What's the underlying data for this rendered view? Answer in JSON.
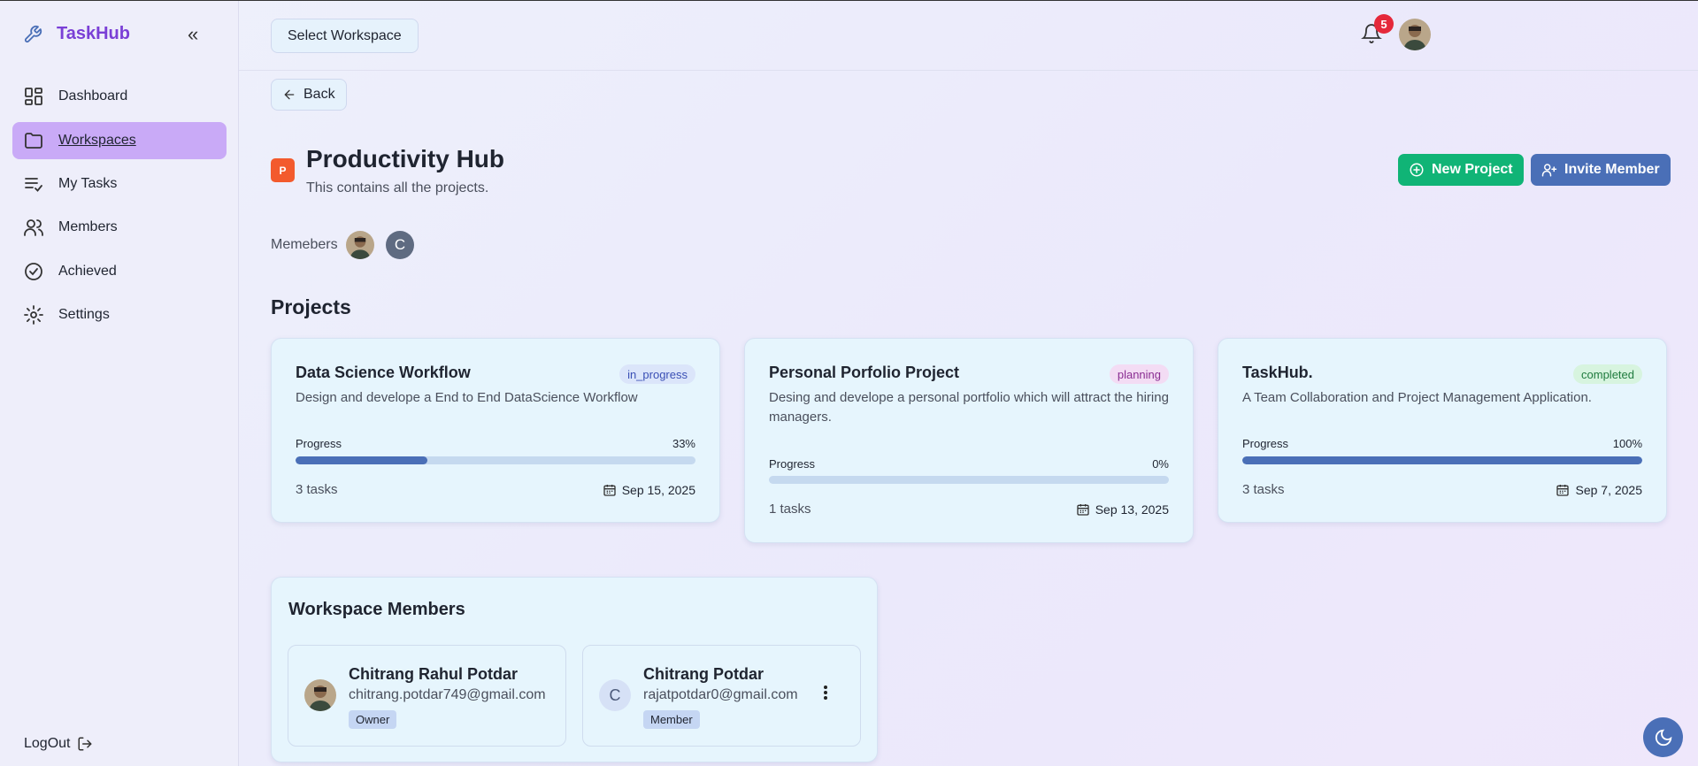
{
  "app": {
    "name": "TaskHub"
  },
  "sidebar": {
    "items": [
      {
        "label": "Dashboard",
        "icon": "dashboard-icon"
      },
      {
        "label": "Workspaces",
        "icon": "folder-icon",
        "active": true
      },
      {
        "label": "My Tasks",
        "icon": "list-check-icon"
      },
      {
        "label": "Members",
        "icon": "users-icon"
      },
      {
        "label": "Achieved",
        "icon": "check-circle-icon"
      },
      {
        "label": "Settings",
        "icon": "gear-icon"
      }
    ],
    "logout": "LogOut"
  },
  "header": {
    "workspace_select": "Select Workspace",
    "notifications": "5"
  },
  "workspace": {
    "back": "Back",
    "initial": "P",
    "name": "Productivity Hub",
    "description": "This contains all the projects.",
    "members_label": "Memebers",
    "member_initial": "C",
    "new_project": "New Project",
    "invite_member": "Invite Member"
  },
  "projects": {
    "heading": "Projects",
    "progress_label": "Progress",
    "list": [
      {
        "title": "Data Science Workflow",
        "status": "in_progress",
        "description": "Design and develope a End to End DataScience Workflow",
        "progress": 33,
        "progress_text": "33%",
        "tasks": "3 tasks",
        "due": "Sep 15, 2025"
      },
      {
        "title": "Personal Porfolio Project",
        "status": "planning",
        "description": "Desing and develope a personal portfolio which will attract the hiring managers.",
        "progress": 0,
        "progress_text": "0%",
        "tasks": "1 tasks",
        "due": "Sep 13, 2025"
      },
      {
        "title": "TaskHub.",
        "status": "completed",
        "description": "A Team Collaboration and Project Management Application.",
        "progress": 100,
        "progress_text": "100%",
        "tasks": "3 tasks",
        "due": "Sep 7, 2025"
      }
    ]
  },
  "members": {
    "heading": "Workspace Members",
    "list": [
      {
        "name": "Chitrang Rahul Potdar",
        "email": "chitrang.potdar749@gmail.com",
        "role": "Owner"
      },
      {
        "name": "Chitrang Potdar",
        "email": "rajatpotdar0@gmail.com",
        "role": "Member",
        "initial": "C"
      }
    ]
  },
  "colors": {
    "brand": "#7a3fd6",
    "active_nav": "#c9aaf7",
    "new_project": "#10b476",
    "invite": "#4a6fb7",
    "progress": "#4a6fb7"
  }
}
